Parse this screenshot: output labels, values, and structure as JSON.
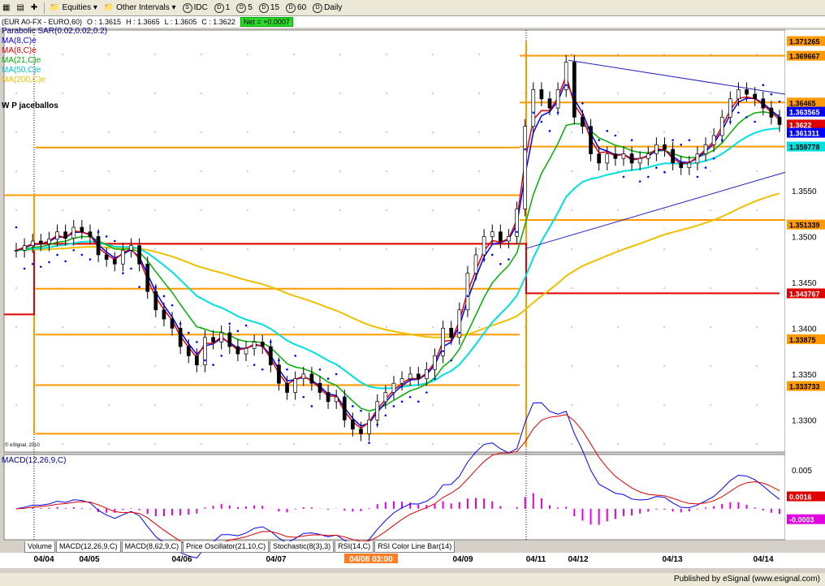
{
  "toolbar": {
    "symbol_icon": "menu-icon",
    "equities": "Equities",
    "other_intervals": "Other Intervals",
    "idc": "IDC",
    "i1": "1",
    "i5": "5",
    "i15": "15",
    "i60": "60",
    "daily": "Daily",
    "circle_s": "S",
    "circle_d": "D"
  },
  "infobar": {
    "symbol": "(EUR A0-FX - EURO,60)",
    "open": "O : 1.3615",
    "high": "H : 1.3665",
    "low": "L : 1.3605",
    "close": "C : 1.3622",
    "net": "Net = +0.0007"
  },
  "legend": {
    "psar": "Parabolic SAR(0.02,0.02,0.2)",
    "ma8a": "MA(8,C)e",
    "ma8b": "MA(8,C)e",
    "ma21": "MA(21,C)e",
    "ma50": "MA(50,C)e",
    "ma200": "MA(200,C)e",
    "author": "W P jaceballos"
  },
  "macd_label": "MACD(12,26,9,C)",
  "esignal_copy": "© eSignal, 2010",
  "tabs": [
    "Volume",
    "MACD(12,26,9,C)",
    "MACD(8,62,9,C)",
    "Price Oscillator(21,10,C)",
    "Stochastic(8(3),3)",
    "RSI(14,C)",
    "RSI Color Line Bar(14)"
  ],
  "status": "Published by eSignal (www.esignal.com)",
  "colors": {
    "orange": "#ff9a00",
    "red": "#e00000",
    "blue": "#0000ff",
    "green": "#00b000",
    "cyan": "#00e0e0",
    "gold": "#f0c000"
  },
  "chart_data": {
    "type": "line",
    "x_tick_labels": [
      "04/04",
      "04/05",
      "04/06",
      "04/07",
      "04/08 03:00",
      "04/09",
      "04/11",
      "04/12",
      "04/13",
      "04/14"
    ],
    "y_tick_labels": [
      "1.3550",
      "1.3500",
      "1.3450",
      "1.3400",
      "1.3350",
      "1.3300"
    ],
    "ylim": [
      1.3265,
      1.3725
    ],
    "price_labels": [
      {
        "text": "1.371265",
        "value": 1.3713,
        "color": "#ff9a00"
      },
      {
        "text": "1.369667",
        "value": 1.3697,
        "color": "#ff9a00"
      },
      {
        "text": "1.36465",
        "value": 1.3646,
        "color": "#ff9a00"
      },
      {
        "text": "1.363565",
        "value": 1.3636,
        "color": "#0000ff"
      },
      {
        "text": "1.3622",
        "value": 1.3622,
        "color": "#e00000"
      },
      {
        "text": "1.361311",
        "value": 1.3613,
        "color": "#0000ff"
      },
      {
        "text": "1.359778",
        "value": 1.3598,
        "color": "#00e0e0"
      },
      {
        "text": "1.351339",
        "value": 1.3513,
        "color": "#ff9a00"
      },
      {
        "text": "1.343767",
        "value": 1.3438,
        "color": "#e00000"
      },
      {
        "text": "1.33875",
        "value": 1.3388,
        "color": "#ff9a00"
      },
      {
        "text": "1.333733",
        "value": 1.3337,
        "color": "#ff9a00"
      }
    ],
    "series": [
      {
        "name": "Close",
        "values": [
          1.3485,
          1.349,
          1.3495,
          1.3492,
          1.3497,
          1.3505,
          1.3498,
          1.351,
          1.3505,
          1.35,
          1.348,
          1.3475,
          1.347,
          1.3485,
          1.349,
          1.347,
          1.344,
          1.342,
          1.341,
          1.34,
          1.338,
          1.337,
          1.336,
          1.339,
          1.3385,
          1.3395,
          1.338,
          1.3372,
          1.3378,
          1.3385,
          1.338,
          1.336,
          1.334,
          1.333,
          1.3345,
          1.335,
          1.334,
          1.333,
          1.332,
          1.3325,
          1.33,
          1.329,
          1.3285,
          1.33,
          1.332,
          1.333,
          1.334,
          1.3345,
          1.335,
          1.3345,
          1.3355,
          1.337,
          1.34,
          1.339,
          1.342,
          1.346,
          1.348,
          1.35,
          1.3505,
          1.3495,
          1.35,
          1.353,
          1.362,
          1.366,
          1.365,
          1.364,
          1.366,
          1.369,
          1.363,
          1.362,
          1.359,
          1.358,
          1.359,
          1.3585,
          1.359,
          1.358,
          1.3585,
          1.359,
          1.36,
          1.3595,
          1.358,
          1.3575,
          1.358,
          1.359,
          1.36,
          1.361,
          1.363,
          1.365,
          1.366,
          1.3655,
          1.365,
          1.364,
          1.363,
          1.3622
        ]
      }
    ],
    "levels": [
      1.3713,
      1.3697,
      1.3646,
      1.3598,
      1.3513,
      1.3438,
      1.3388,
      1.3337,
      1.3285
    ],
    "macd": {
      "ylim": [
        -0.004,
        0.007
      ],
      "tick_labels": [
        "0.005"
      ],
      "last_macd": "0.0016",
      "last_hist": "-0.0003"
    }
  }
}
